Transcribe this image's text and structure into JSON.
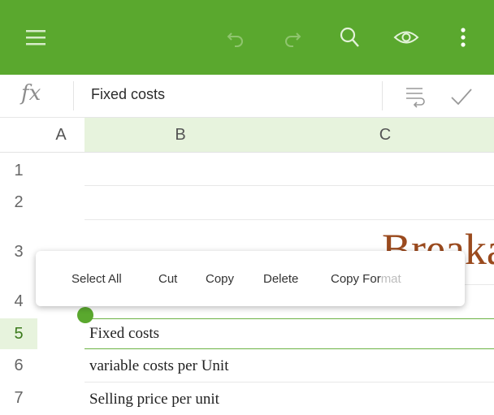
{
  "toolbar": {
    "menu_icon": "menu-icon",
    "undo_icon": "undo-icon",
    "redo_icon": "redo-icon",
    "search_icon": "search-icon",
    "view_icon": "eye-icon",
    "more_icon": "more-vertical-icon",
    "background_color": "#5aa82e"
  },
  "formula_bar": {
    "fx_label": "fx",
    "value": "Fixed costs"
  },
  "columns": [
    "A",
    "B",
    "C"
  ],
  "rows": [
    "1",
    "2",
    "3",
    "4",
    "5",
    "6",
    "7"
  ],
  "cells": {
    "title_partial": "Breakak",
    "b5": "Fixed costs",
    "b6": "variable costs per Unit",
    "b7": "Selling price per unit"
  },
  "context_menu": {
    "select_all": "Select All",
    "cut": "Cut",
    "copy": "Copy",
    "delete": "Delete",
    "copy_format_main": "Copy For",
    "copy_format_faded": "mat"
  }
}
